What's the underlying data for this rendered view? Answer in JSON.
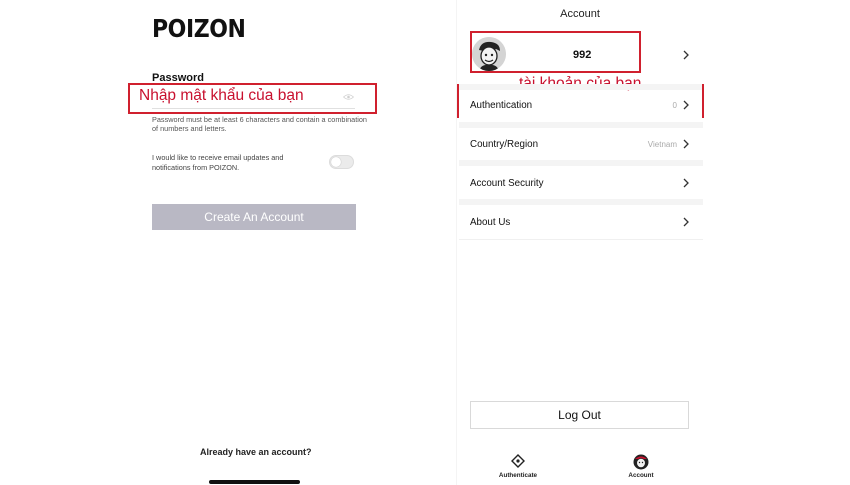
{
  "left_screen": {
    "logo": "POIZON",
    "password_label": "Password",
    "password_value": "",
    "password_hint": "Password must be at least 6 characters and contain a combination of numbers and letters.",
    "annotation": "Nhập mật khẩu của bạn",
    "email_updates_text": "I would like to receive email updates and notifications from POIZON.",
    "email_updates_enabled": false,
    "create_button": "Create An Account",
    "already_account": "Already have an account?"
  },
  "right_screen": {
    "title": "Account",
    "account_number": "992",
    "annotation": "tài khoản của bạn",
    "menu": [
      {
        "label": "Authentication",
        "value": "0"
      },
      {
        "label": "Country/Region",
        "value": "Vietnam"
      },
      {
        "label": "Account Security",
        "value": ""
      },
      {
        "label": "About Us",
        "value": ""
      }
    ],
    "logout": "Log Out",
    "tabs": [
      {
        "label": "Authenticate",
        "icon": "diamond-tag-icon"
      },
      {
        "label": "Account",
        "icon": "user-avatar-icon"
      }
    ]
  },
  "colors": {
    "annotation_red": "#d0202e",
    "button_disabled": "#b9b8c4",
    "separator": "#f4f4f4"
  }
}
